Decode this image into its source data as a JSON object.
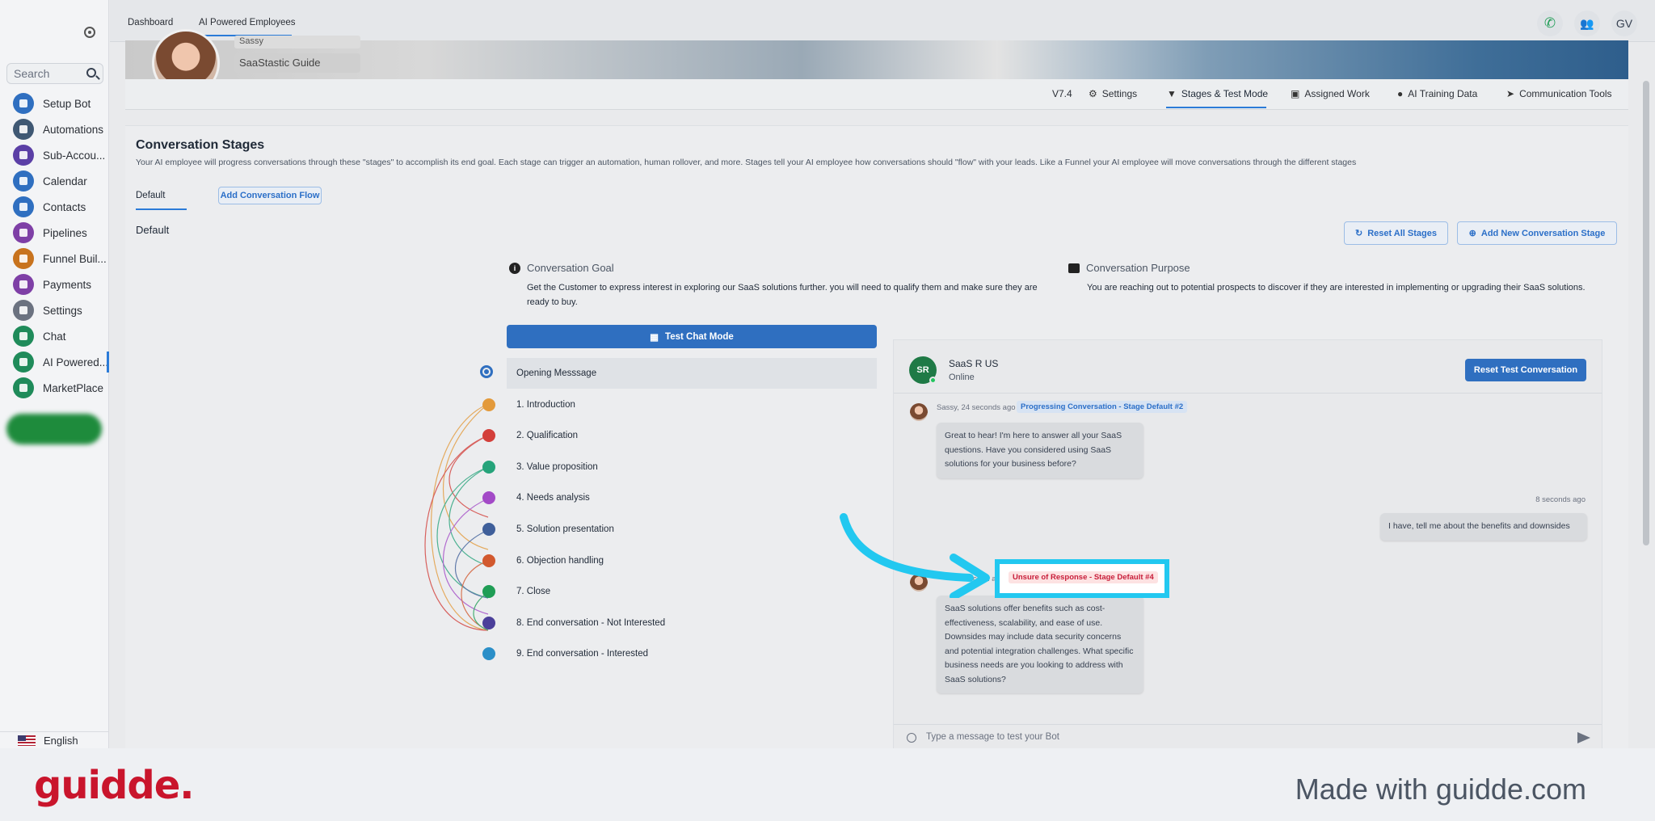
{
  "sidebar": {
    "search_placeholder": "Search",
    "items": [
      {
        "label": "Setup Bot",
        "color": "#2f6fc0"
      },
      {
        "label": "Automations",
        "color": "#3f5873"
      },
      {
        "label": "Sub-Accou...",
        "color": "#5b3fa6"
      },
      {
        "label": "Calendar",
        "color": "#2f6fc0"
      },
      {
        "label": "Contacts",
        "color": "#2f6fc0"
      },
      {
        "label": "Pipelines",
        "color": "#7e3fa6"
      },
      {
        "label": "Funnel Buil...",
        "color": "#c8731e"
      },
      {
        "label": "Payments",
        "color": "#7e3fa6"
      },
      {
        "label": "Settings",
        "color": "#6b7280"
      },
      {
        "label": "Chat",
        "color": "#1f8b5a"
      },
      {
        "label": "AI Powered...",
        "color": "#1f8b5a"
      },
      {
        "label": "MarketPlace",
        "color": "#1f8b5a"
      }
    ],
    "language": "English"
  },
  "topbar": {
    "breadcrumb_dashboard": "Dashboard",
    "breadcrumb_ai": "AI Powered Employees",
    "user_initials": "GV"
  },
  "banner": {
    "name": "Sassy",
    "guide": "SaaStastic Guide"
  },
  "tabs": {
    "version": "V7.4",
    "settings": "Settings",
    "stages": "Stages & Test Mode",
    "assigned": "Assigned Work",
    "training": "AI Training Data",
    "communication": "Communication Tools"
  },
  "stages_page": {
    "title": "Conversation Stages",
    "description": "Your AI employee will progress conversations through these \"stages\" to accomplish its end goal. Each stage can trigger an automation, human rollover, and more. Stages tell your AI employee how conversations should \"flow\" with your leads. Like a Funnel your AI employee will move conversations through the different stages",
    "tab_default": "Default",
    "add_flow": "Add Conversation Flow",
    "section_default": "Default",
    "reset_all": "Reset All Stages",
    "add_stage": "Add New Conversation Stage",
    "goal_label": "Conversation Goal",
    "goal_text": "Get the Customer to express interest in exploring our SaaS solutions further. you will need to qualify them and make sure they are ready to buy.",
    "purpose_label": "Conversation Purpose",
    "purpose_text": "You are reaching out to potential prospects to discover if they are interested in implementing or upgrading their SaaS solutions.",
    "test_chat": "Test Chat Mode",
    "stages": [
      {
        "label": "Opening Messsage",
        "dot": ""
      },
      {
        "label": "1. Introduction",
        "dot": "#e39a3b"
      },
      {
        "label": "2. Qualification",
        "dot": "#d33f3a"
      },
      {
        "label": "3. Value proposition",
        "dot": "#25a37a"
      },
      {
        "label": "4. Needs analysis",
        "dot": "#a34ac7"
      },
      {
        "label": "5. Solution presentation",
        "dot": "#3f5f9a"
      },
      {
        "label": "6. Objection handling",
        "dot": "#d2592e"
      },
      {
        "label": "7. Close",
        "dot": "#1f9d55"
      },
      {
        "label": "8. End conversation - Not Interested",
        "dot": "#4b3f9a"
      },
      {
        "label": "9. End conversation - Interested",
        "dot": "#2b8fc8"
      }
    ]
  },
  "chat": {
    "contact_initials": "SR",
    "contact_name": "SaaS R US",
    "status": "Online",
    "reset_button": "Reset Test Conversation",
    "msg1_meta": "Sassy, 24 seconds ago",
    "msg1_tag": "Progressing Conversation - Stage Default #2",
    "msg1_text": "Great to hear! I'm here to answer all your SaaS questions. Have you considered using SaaS solutions for your business before?",
    "msg2_meta": "8 seconds ago",
    "msg2_text": "I have, tell me about the benefits and downsides",
    "msg3_meta": "second a",
    "msg3_tag": "Unsure of Response - Stage Default #4",
    "msg3_text": "SaaS solutions offer benefits such as cost-effectiveness, scalability, and ease of use. Downsides may include data security concerns and potential integration challenges. What specific business needs are you looking to address with SaaS solutions?",
    "input_placeholder": "Type a message to test your Bot"
  },
  "footer": {
    "logo": "guidde.",
    "made_with": "Made with guidde.com"
  },
  "colors": {
    "accent": "#2f6fc0",
    "highlight": "#22c8f0",
    "brand": "#c9152c"
  }
}
